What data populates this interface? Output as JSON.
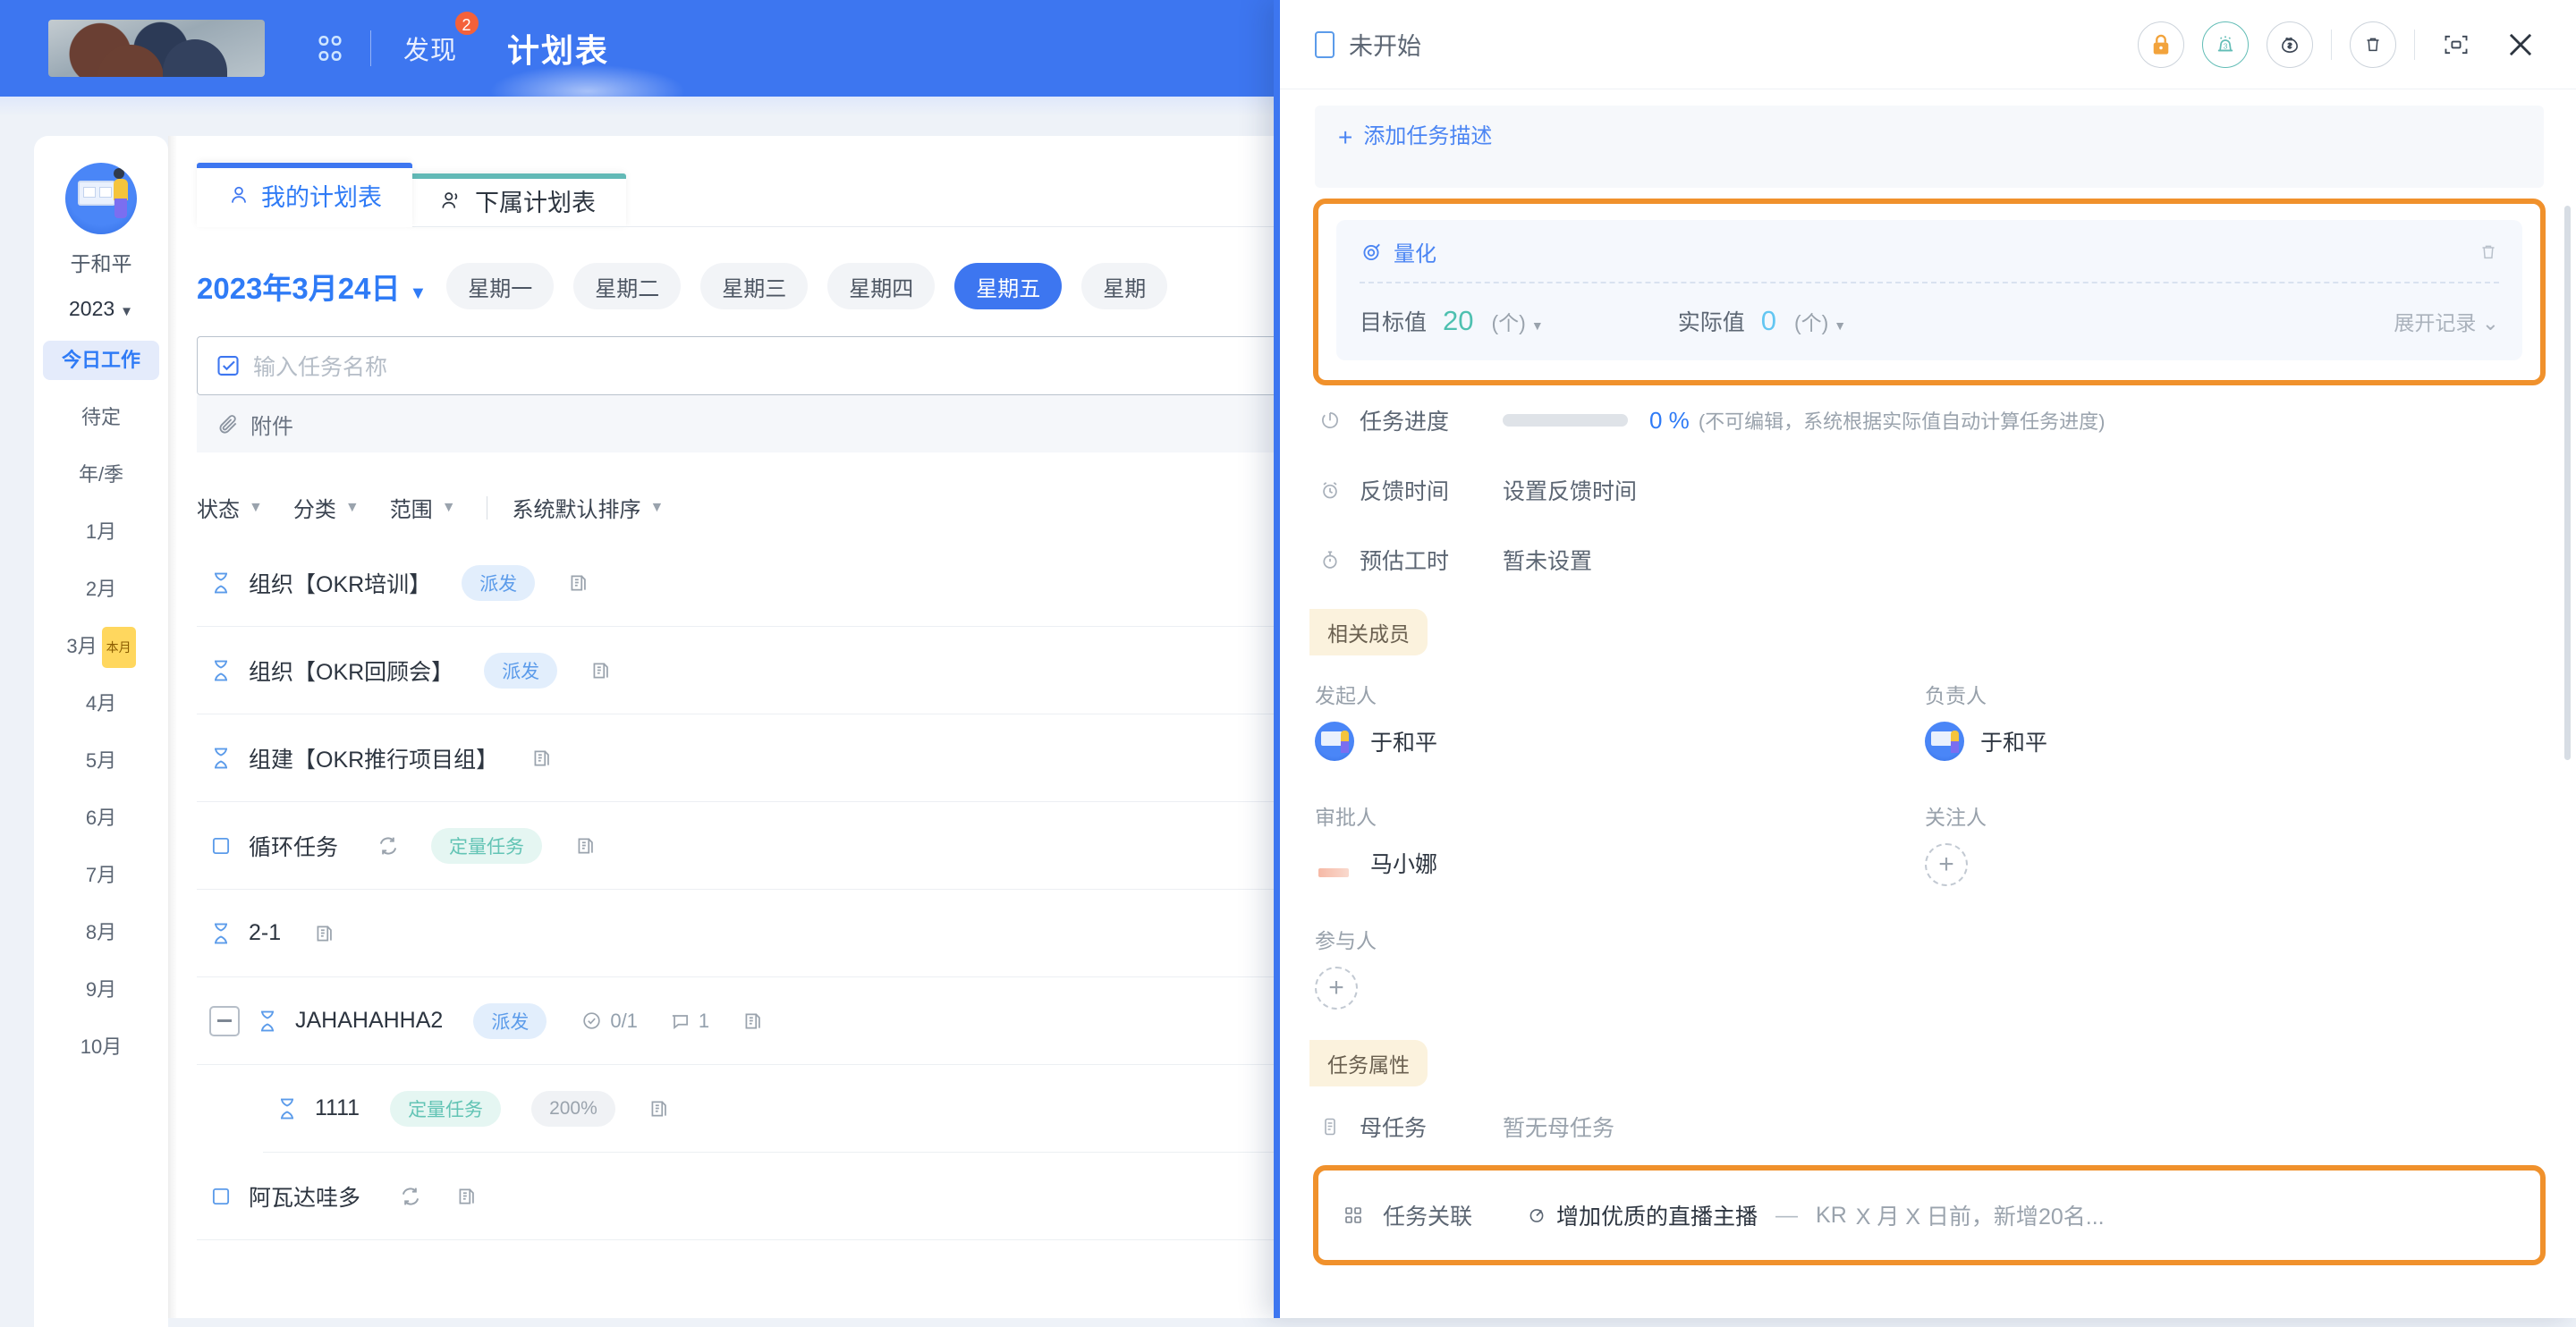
{
  "topbar": {
    "logo_alt": "anime-logo",
    "grid_icon": "grid-icon",
    "discover_label": "发现",
    "discover_badge": "2",
    "title": "计划表"
  },
  "sidebar": {
    "user_name": "于和平",
    "year": "2023",
    "year_caret": "▼",
    "items": [
      {
        "label": "今日工作",
        "active": true
      },
      {
        "label": "待定",
        "active": false
      },
      {
        "label": "年/季",
        "active": false
      },
      {
        "label": "1月",
        "active": false
      },
      {
        "label": "2月",
        "active": false
      },
      {
        "label": "3月",
        "active": false,
        "tag": "本月"
      },
      {
        "label": "4月",
        "active": false
      },
      {
        "label": "5月",
        "active": false
      },
      {
        "label": "6月",
        "active": false
      },
      {
        "label": "7月",
        "active": false
      },
      {
        "label": "8月",
        "active": false
      },
      {
        "label": "9月",
        "active": false
      },
      {
        "label": "10月",
        "active": false
      }
    ]
  },
  "main": {
    "tabs": [
      {
        "label": "我的计划表",
        "icon": "user-icon",
        "active": true
      },
      {
        "label": "下属计划表",
        "icon": "users-icon",
        "active": false
      }
    ],
    "date": {
      "label": "2023年3月24日",
      "caret": "▼"
    },
    "weekdays": [
      {
        "label": "星期一",
        "selected": false
      },
      {
        "label": "星期二",
        "selected": false
      },
      {
        "label": "星期三",
        "selected": false
      },
      {
        "label": "星期四",
        "selected": false
      },
      {
        "label": "星期五",
        "selected": true
      },
      {
        "label": "星期",
        "selected": false
      }
    ],
    "new_task": {
      "icon": "checkbox-check-icon",
      "placeholder": "输入任务名称"
    },
    "attachment": {
      "icon": "paperclip-icon",
      "label": "附件"
    },
    "filters": [
      {
        "label": "状态",
        "caret": "▼"
      },
      {
        "label": "分类",
        "caret": "▼"
      },
      {
        "label": "范围",
        "caret": "▼"
      }
    ],
    "sort": {
      "label": "系统默认排序",
      "caret": "▼"
    },
    "tasks": [
      {
        "status_icon": "hourglass-icon",
        "name": "组织【OKR培训】",
        "chip": "派发",
        "chip_kind": "blue",
        "copy": true
      },
      {
        "status_icon": "hourglass-icon",
        "name": "组织【OKR回顾会】",
        "chip": "派发",
        "chip_kind": "blue",
        "copy": true
      },
      {
        "status_icon": "hourglass-icon",
        "name": "组建【OKR推行项目组】",
        "chip": "",
        "chip_kind": "",
        "copy": true
      },
      {
        "status_icon": "square-icon",
        "name": "循环任务",
        "recur": true,
        "chip": "定量任务",
        "chip_kind": "green",
        "copy": true
      },
      {
        "status_icon": "hourglass-icon",
        "name": "2-1",
        "chip": "",
        "chip_kind": "",
        "copy": true
      },
      {
        "status_icon": "hourglass-icon",
        "name": "JAHAHAHHA2",
        "chip": "派发",
        "chip_kind": "blue",
        "expander": true,
        "subtask_count": "0/1",
        "comment_count": "1",
        "copy": true
      },
      {
        "status_icon": "hourglass-icon",
        "name": "1111",
        "chip": "定量任务",
        "chip_kind": "green",
        "chip2": "200%",
        "chip2_kind": "grey",
        "sub": true,
        "copy": true
      },
      {
        "status_icon": "square-icon",
        "name": "阿瓦达哇多",
        "recur": true,
        "chip": "",
        "chip_kind": "",
        "copy": true
      }
    ]
  },
  "panel": {
    "status": "未开始",
    "status_icon": "status-box-icon",
    "actions": [
      {
        "name": "lock-icon",
        "color": "#f2a33c",
        "ring": "#ccd3db"
      },
      {
        "name": "alarm-3-icon",
        "color": "#62bdb6",
        "ring": "#62bdb6"
      },
      {
        "name": "money-bag-icon",
        "color": "#3c4654",
        "ring": "#ccd3db"
      },
      {
        "name": "trash-icon",
        "color": "#3c4654",
        "ring": "#ccd3db"
      },
      {
        "name": "expand-icon",
        "color": "#3c4654",
        "ring": "none"
      },
      {
        "name": "close-icon",
        "color": "#2d3540",
        "ring": "none"
      }
    ],
    "description": {
      "plus": "+",
      "label": "添加任务描述"
    },
    "quantification": {
      "icon": "target-icon",
      "title": "量化",
      "delete_icon": "trash-icon",
      "target_label": "目标值",
      "target_value": "20",
      "target_unit": "(个)",
      "actual_label": "实际值",
      "actual_value": "0",
      "actual_unit": "(个)",
      "expand_label": "展开记录",
      "expand_caret": "⌄",
      "highlighted": true
    },
    "info_rows": [
      {
        "icon": "progress-circle-icon",
        "label": "任务进度",
        "progress": true,
        "pct": "0 %",
        "hint": "(不可编辑，系统根据实际值自动计算任务进度)"
      },
      {
        "icon": "alarm-clock-icon",
        "label": "反馈时间",
        "value": "设置反馈时间"
      },
      {
        "icon": "stopwatch-icon",
        "label": "预估工时",
        "value": "暂未设置"
      }
    ],
    "members_section_title": "相关成员",
    "members": {
      "creator_label": "发起人",
      "creator_name": "于和平",
      "owner_label": "负责人",
      "owner_name": "于和平",
      "approver_label": "审批人",
      "approver_name": "马小娜",
      "follower_label": "关注人",
      "follower_add": "+",
      "participant_label": "参与人",
      "participant_add": "+"
    },
    "attrs_section_title": "任务属性",
    "attrs": [
      {
        "icon": "doc-icon",
        "label": "母任务",
        "value": "暂无母任务",
        "highlighted": false
      }
    ],
    "relation": {
      "icon": "grid4-icon",
      "label": "任务关联",
      "target_icon": "target-small-icon",
      "objective": "增加优质的直播主播",
      "dash": "—",
      "kr_tag": "KR",
      "kr_text": "X 月 X 日前，新增20名...",
      "highlighted": true
    }
  },
  "colors": {
    "brand_blue": "#3d76f0",
    "accent_orange": "#f0912c",
    "teal": "#4ec0b0",
    "chip_blue_bg": "#e2eefc",
    "chip_green_bg": "#e5f6f2"
  }
}
